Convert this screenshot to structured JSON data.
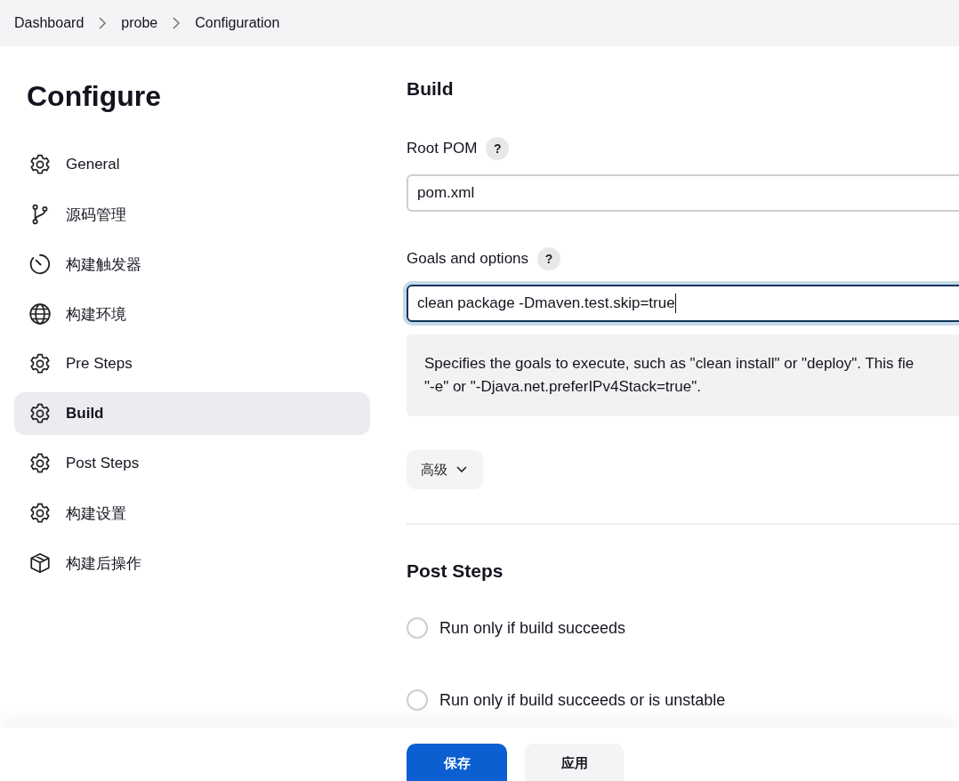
{
  "breadcrumb": [
    "Dashboard",
    "probe",
    "Configuration"
  ],
  "sidebar": {
    "title": "Configure",
    "items": [
      {
        "label": "General",
        "kind": "gear",
        "selected": false
      },
      {
        "label": "源码管理",
        "kind": "branch",
        "selected": false
      },
      {
        "label": "构建触发器",
        "kind": "timer",
        "selected": false
      },
      {
        "label": "构建环境",
        "kind": "globe",
        "selected": false
      },
      {
        "label": "Pre Steps",
        "kind": "gear",
        "selected": false
      },
      {
        "label": "Build",
        "kind": "gear",
        "selected": true
      },
      {
        "label": "Post Steps",
        "kind": "gear",
        "selected": false
      },
      {
        "label": "构建设置",
        "kind": "gear",
        "selected": false
      },
      {
        "label": "构建后操作",
        "kind": "package",
        "selected": false
      }
    ]
  },
  "build": {
    "title": "Build",
    "fields": [
      {
        "label": "Root POM",
        "help": "?",
        "value": "pom.xml",
        "focused": false
      },
      {
        "label": "Goals and options",
        "help": "?",
        "value": "clean package -Dmaven.test.skip=true",
        "focused": true
      }
    ],
    "help_text": [
      "Specifies the goals to execute, such as \"clean install\" or \"deploy\". This fie",
      "\"-e\" or \"-Djava.net.preferIPv4Stack=true\"."
    ],
    "advanced": "高级"
  },
  "post_steps": {
    "title": "Post Steps",
    "options": [
      {
        "label": "Run only if build succeeds",
        "selected": false
      },
      {
        "label": "Run only if build succeeds or is unstable",
        "selected": false
      }
    ]
  },
  "buttons": [
    {
      "label": "保存",
      "kind": "primary"
    },
    {
      "label": "应用",
      "kind": "secondary"
    }
  ]
}
